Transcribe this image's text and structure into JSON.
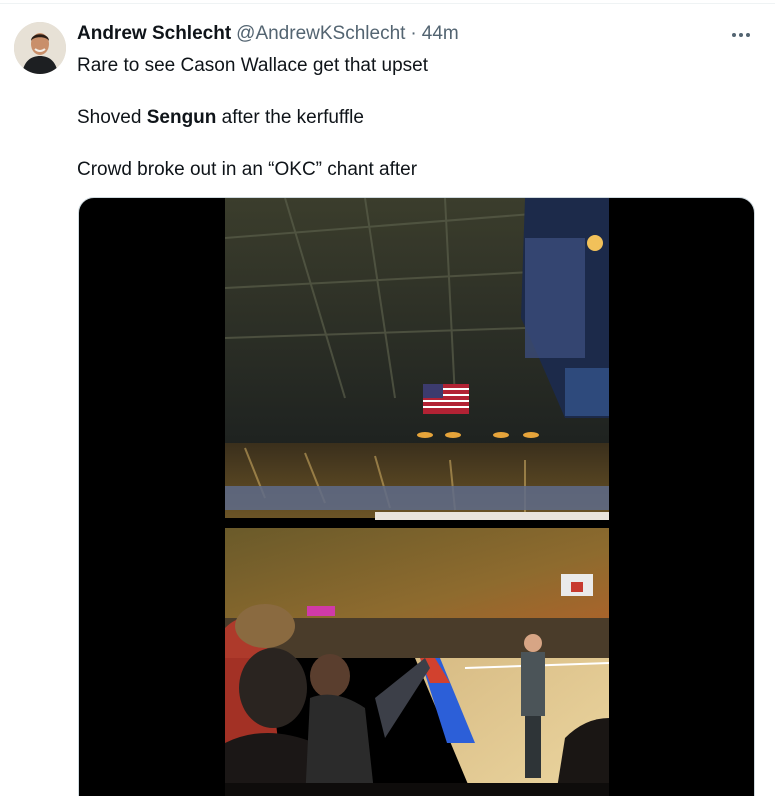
{
  "tweet": {
    "author": {
      "display_name": "Andrew Schlecht",
      "handle": "@AndrewKSchlecht",
      "separator": "·",
      "time": "44m",
      "avatar_icon": "user-avatar"
    },
    "menu_icon": "more-horizontal-icon",
    "lines": [
      {
        "text": "Rare to see Cason Wallace get that upset"
      },
      {
        "prefix": "Shoved ",
        "bold": "Sengun",
        "suffix": " after the kerfuffle"
      },
      {
        "text": "Crowd broke out in an “OKC” chant after"
      }
    ],
    "media": {
      "type": "video",
      "description_icon": "video-thumbnail",
      "colors": {
        "background": "#000000",
        "court": "#e0c48a",
        "flag_red": "#b22234"
      }
    }
  }
}
